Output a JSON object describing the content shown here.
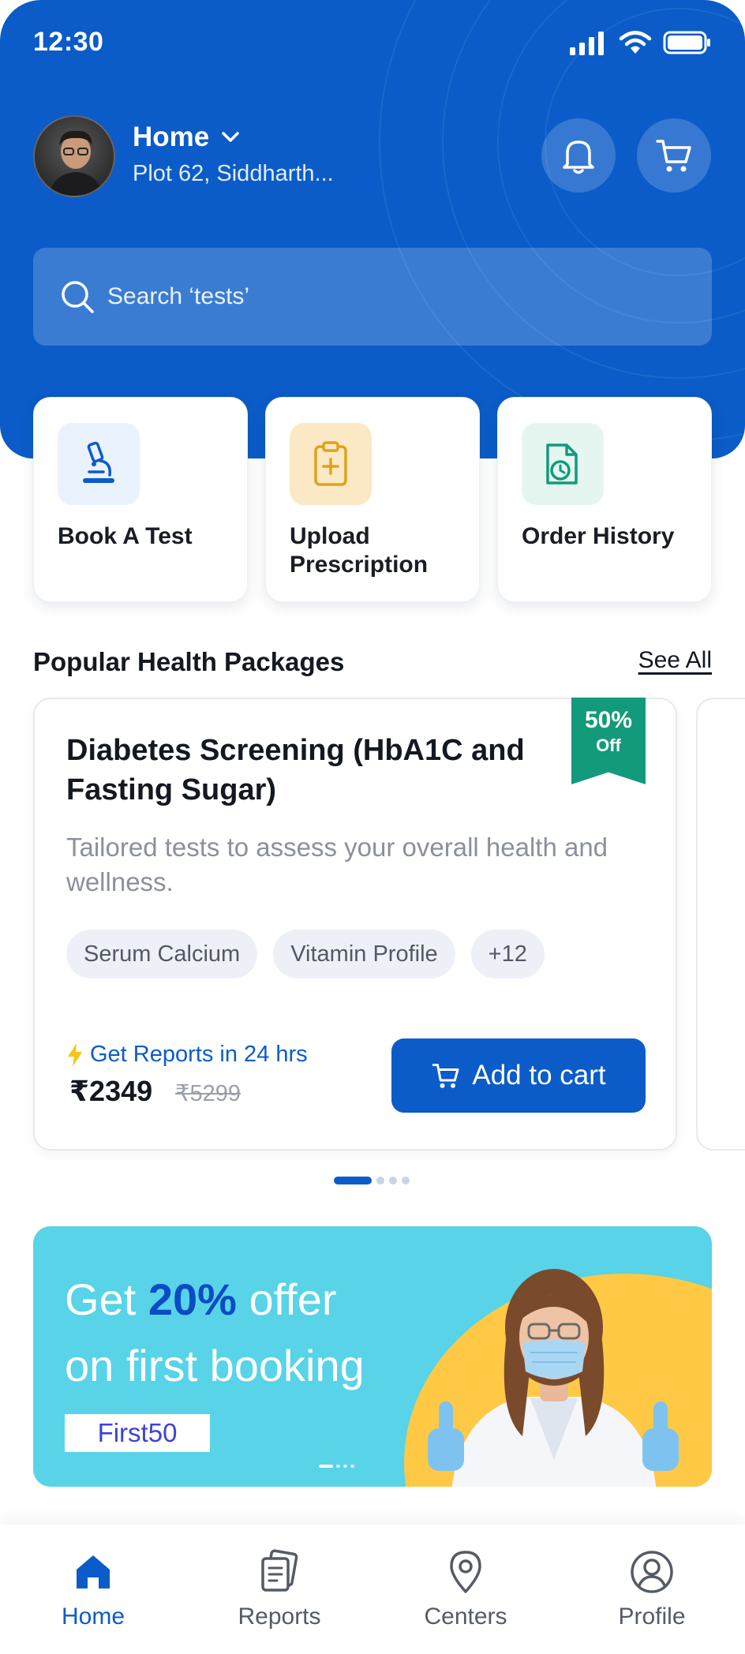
{
  "status_bar": {
    "time": "12:30"
  },
  "location": {
    "title": "Home",
    "address": "Plot 62, Siddharth..."
  },
  "search": {
    "placeholder": "Search ‘tests’"
  },
  "quick_actions": [
    {
      "label": "Book A Test",
      "icon": "microscope-icon"
    },
    {
      "label": "Upload Prescription",
      "icon": "clipboard-plus-icon"
    },
    {
      "label": "Order History",
      "icon": "document-clock-icon"
    }
  ],
  "packages_section": {
    "title": "Popular Health Packages",
    "see_all": "See All"
  },
  "package": {
    "title": "Diabetes Screening (HbA1C and Fasting Sugar)",
    "description": "Tailored tests to assess your overall health and wellness.",
    "discount_pct": "50%",
    "discount_off": "Off",
    "tags": [
      "Serum Calcium",
      "Vitamin Profile",
      "+12"
    ],
    "report_time": "Get Reports in 24 hrs",
    "price": "₹2349",
    "old_price": "₹5299",
    "cta": "Add to cart"
  },
  "carousel": {
    "active_index": 0,
    "count": 4
  },
  "promo": {
    "line1_prefix": "Get",
    "line1_highlight": "20%",
    "line1_suffix": "offer",
    "line2": "on first booking",
    "coupon": "First50"
  },
  "bottom_nav": [
    {
      "label": "Home",
      "icon": "home-icon",
      "active": true
    },
    {
      "label": "Reports",
      "icon": "reports-icon",
      "active": false
    },
    {
      "label": "Centers",
      "icon": "location-pin-icon",
      "active": false
    },
    {
      "label": "Profile",
      "icon": "user-circle-icon",
      "active": false
    }
  ],
  "colors": {
    "primary": "#0b5cc8",
    "accent_green": "#139a7b",
    "promo_bg": "#58d3e8",
    "promo_blob": "#ffc945"
  }
}
